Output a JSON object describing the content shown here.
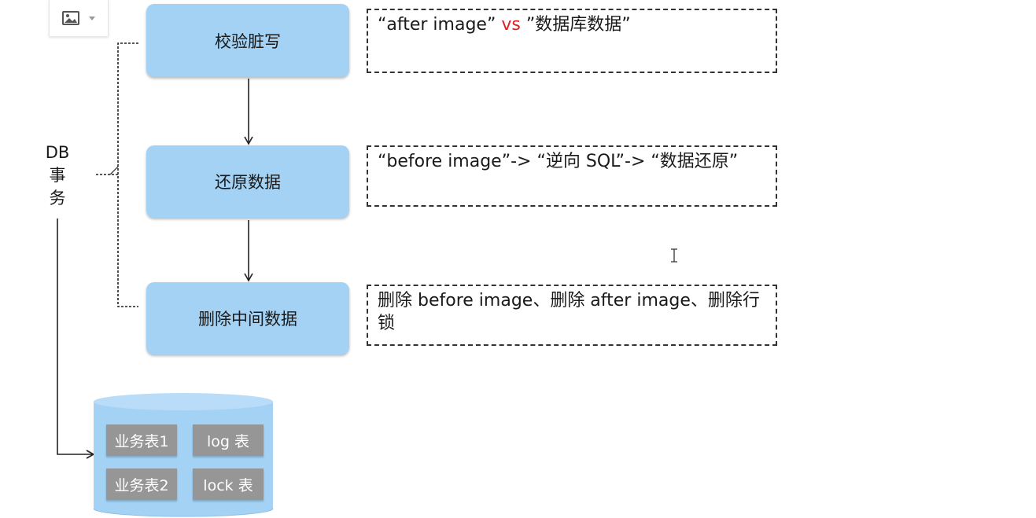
{
  "toolbar": {
    "image_icon": "image-icon",
    "dropdown_icon": "caret-down-icon"
  },
  "steps": [
    {
      "label": "校验脏写"
    },
    {
      "label": "还原数据"
    },
    {
      "label": "删除中间数据"
    }
  ],
  "notes": [
    {
      "part1": "“after  image”  ",
      "part2": "vs",
      "part3": " ”数据库数据”"
    },
    {
      "text": "“before image”-> “逆向 SQL”-> “数据还原”"
    },
    {
      "text": "删除 before image、删除 after image、删除行锁"
    }
  ],
  "db_label": {
    "line1": "DB",
    "line2": "事",
    "line3": "务"
  },
  "database": {
    "tables": [
      "业务表1",
      "log 表",
      "业务表2",
      "lock 表"
    ]
  },
  "colors": {
    "step_fill": "#a3d2f5",
    "cylinder_fill": "#a3d2f5",
    "table_fill": "#969696",
    "highlight": "#e02020"
  }
}
